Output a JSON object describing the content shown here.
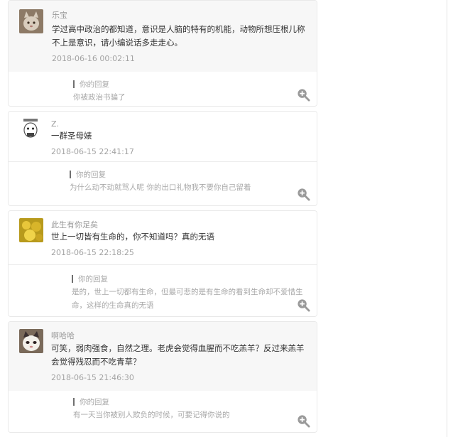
{
  "reply_label": "你的回复",
  "comments": [
    {
      "username": "乐宝",
      "content": "学过高中政治的都知道，意识是人脑的特有的机能，动物所想压根儿称不上是意识，请小编说话多走走心。",
      "time": "2018-06-16 00:02:11",
      "reply": "你被政治书骗了"
    },
    {
      "username": "Z.",
      "content": "一群圣母婊",
      "time": "2018-06-15 22:41:17",
      "reply": "为什么动不动就骂人呢 你的出口礼物我不要你自己留着"
    },
    {
      "username": "此生有你足矣",
      "content": "世上一切皆有生命的，你不知道吗？真的无语",
      "time": "2018-06-15 22:18:25",
      "reply": "是的，世上一切都有生命，但最可悲的是有生命的看到生命却不爱惜生命，这样的生命真的无语"
    },
    {
      "username": "啊哈哈",
      "content": "可笑，弱肉强食，自然之理。老虎会觉得血腥而不吃羔羊？反过来羔羊会觉得残忍而不吃青草？",
      "time": "2018-06-15 21:46:30",
      "reply": "有一天当你被别人欺负的时候，可要记得你说的"
    }
  ]
}
